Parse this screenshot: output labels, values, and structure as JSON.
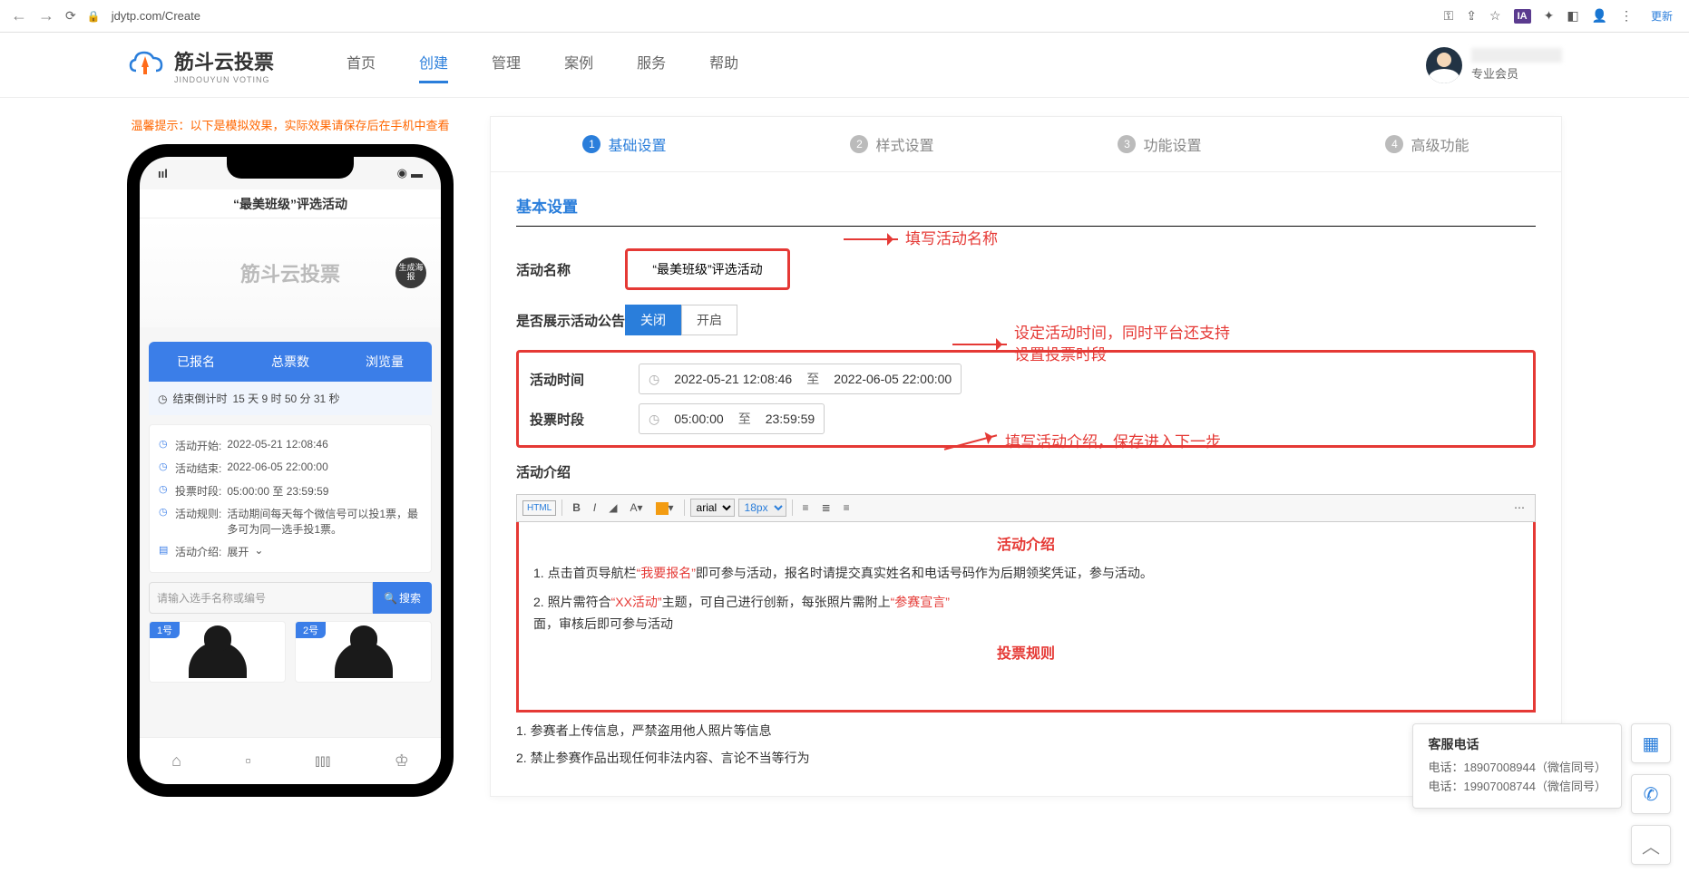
{
  "browser": {
    "url": "jdytp.com/Create",
    "update": "更新"
  },
  "logo": {
    "cn": "筋斗云投票",
    "en": "JINDOUYUN VOTING"
  },
  "nav": [
    "首页",
    "创建",
    "管理",
    "案例",
    "服务",
    "帮助"
  ],
  "user": {
    "level": "专业会员"
  },
  "hint": "温馨提示：以下是模拟效果，实际效果请保存后在手机中查看",
  "phone": {
    "title": "“最美班级”评选活动",
    "banner": "筋斗云投票",
    "poster": "生成海报",
    "tabs": [
      "已报名",
      "总票数",
      "浏览量"
    ],
    "countdown_label": "结束倒计时",
    "countdown_value": "15 天  9 时  50 分  31 秒",
    "info": {
      "start_label": "活动开始:",
      "start_val": "2022-05-21 12:08:46",
      "end_label": "活动结束:",
      "end_val": "2022-06-05 22:00:00",
      "period_label": "投票时段:",
      "period_val": "05:00:00 至 23:59:59",
      "rule_label": "活动规则:",
      "rule_val": "活动期间每天每个微信号可以投1票，最多可为同一选手投1票。",
      "intro_label": "活动介绍:",
      "intro_val": "展开"
    },
    "search_placeholder": "请输入选手名称或编号",
    "search_btn": "搜索",
    "cards": [
      "1号",
      "2号"
    ]
  },
  "steps": [
    "基础设置",
    "样式设置",
    "功能设置",
    "高级功能"
  ],
  "section_title": "基本设置",
  "form": {
    "name_label": "活动名称",
    "name_value": "“最美班级”评选活动",
    "notice_label": "是否展示活动公告",
    "notice_off": "关闭",
    "notice_on": "开启",
    "time_label": "活动时间",
    "time_start": "2022-05-21 12:08:46",
    "time_to": "至",
    "time_end": "2022-06-05 22:00:00",
    "period_label": "投票时段",
    "period_start": "05:00:00",
    "period_to": "至",
    "period_end": "23:59:59",
    "intro_label": "活动介绍"
  },
  "toolbar": {
    "html": "HTML",
    "font": "arial",
    "size": "18px"
  },
  "editor": {
    "h1": "活动介绍",
    "p1a": "1. 点击首页导航栏",
    "p1b": "“我要报名”",
    "p1c": "即可参与活动，报名时请提交真实姓名和电话号码作为后期领奖凭证，参与活动。",
    "p2a": "2. 照片需符合",
    "p2b": "“XX活动”",
    "p2c": "主题，可自己进行创新，每张照片需附上",
    "p2d": "“参赛宣言”",
    "p2e": "面，审核后即可参与活动",
    "h2": "投票规则",
    "r1": "1. 参赛者上传信息，严禁盗用他人照片等信息",
    "r2": "2. 禁止参赛作品出现任何非法内容、言论不当等行为"
  },
  "annotations": {
    "a1": "填写活动名称",
    "a2": "设定活动时间，同时平台还支持设置投票时段",
    "a3": "填写活动介绍，保存进入下一步"
  },
  "tooltip": {
    "title": "客服电话",
    "line1": "电话：18907008944（微信同号）",
    "line2": "电话：19907008744（微信同号）"
  }
}
